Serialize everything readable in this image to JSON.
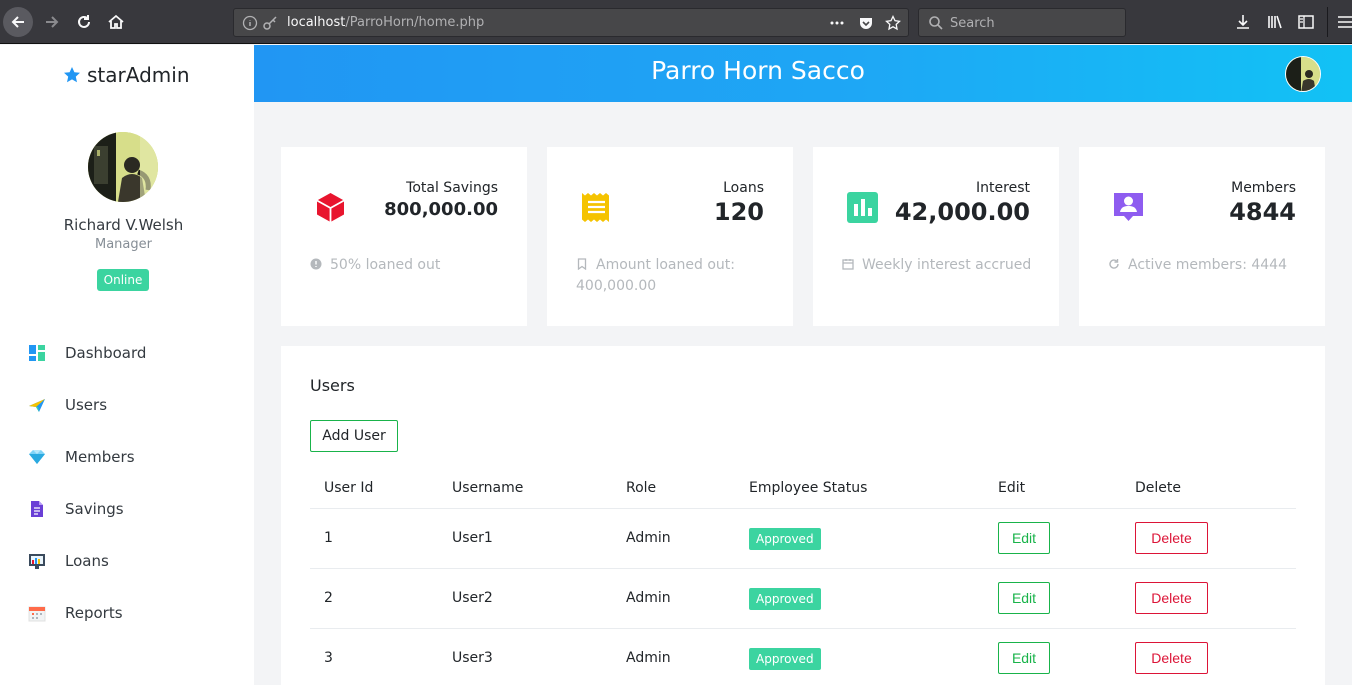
{
  "browser": {
    "url_host": "localhost",
    "url_path": "/ParroHorn/home.php",
    "search_placeholder": "Search"
  },
  "sidebar": {
    "brand_prefix": "star",
    "brand_suffix": "Admin",
    "user_name": "Richard V.Welsh",
    "user_role": "Manager",
    "status": "Online",
    "items": [
      {
        "label": "Dashboard",
        "icon": "dashboard-icon"
      },
      {
        "label": "Users",
        "icon": "paper-plane-icon"
      },
      {
        "label": "Members",
        "icon": "diamond-icon"
      },
      {
        "label": "Savings",
        "icon": "document-icon"
      },
      {
        "label": "Loans",
        "icon": "chart-window-icon"
      },
      {
        "label": "Reports",
        "icon": "calendar-icon"
      }
    ]
  },
  "header": {
    "title": "Parro Horn Sacco"
  },
  "cards": [
    {
      "label": "Total Savings",
      "value": "800,000.00",
      "footer": "50% loaned out",
      "icon": "cube-icon",
      "color": "#e8152e",
      "foot_icon": "alert-circle-icon"
    },
    {
      "label": "Loans",
      "value": "120",
      "footer": "Amount loaned out: 400,000.00",
      "icon": "receipt-icon",
      "color": "#f5c300",
      "foot_icon": "bookmark-icon"
    },
    {
      "label": "Interest",
      "value": "42,000.00",
      "footer": "Weekly interest accrued",
      "icon": "bar-chart-icon",
      "color": "#3bd4a0",
      "foot_icon": "calendar-icon"
    },
    {
      "label": "Members",
      "value": "4844",
      "footer": "Active members: 4444",
      "icon": "account-box-icon",
      "color": "#8e5cf0",
      "foot_icon": "refresh-icon"
    }
  ],
  "users_panel": {
    "title": "Users",
    "add_label": "Add User",
    "columns": [
      "User Id",
      "Username",
      "Role",
      "Employee Status",
      "Edit",
      "Delete"
    ],
    "rows": [
      {
        "id": "1",
        "username": "User1",
        "role": "Admin",
        "status": "Approved",
        "edit": "Edit",
        "delete": "Delete"
      },
      {
        "id": "2",
        "username": "User2",
        "role": "Admin",
        "status": "Approved",
        "edit": "Edit",
        "delete": "Delete"
      },
      {
        "id": "3",
        "username": "User3",
        "role": "Admin",
        "status": "Approved",
        "edit": "Edit",
        "delete": "Delete"
      }
    ]
  },
  "colors": {
    "accent_blue": "#2196f3",
    "success": "#19b34a",
    "danger": "#dc1437",
    "badge": "#3bd4a0"
  }
}
